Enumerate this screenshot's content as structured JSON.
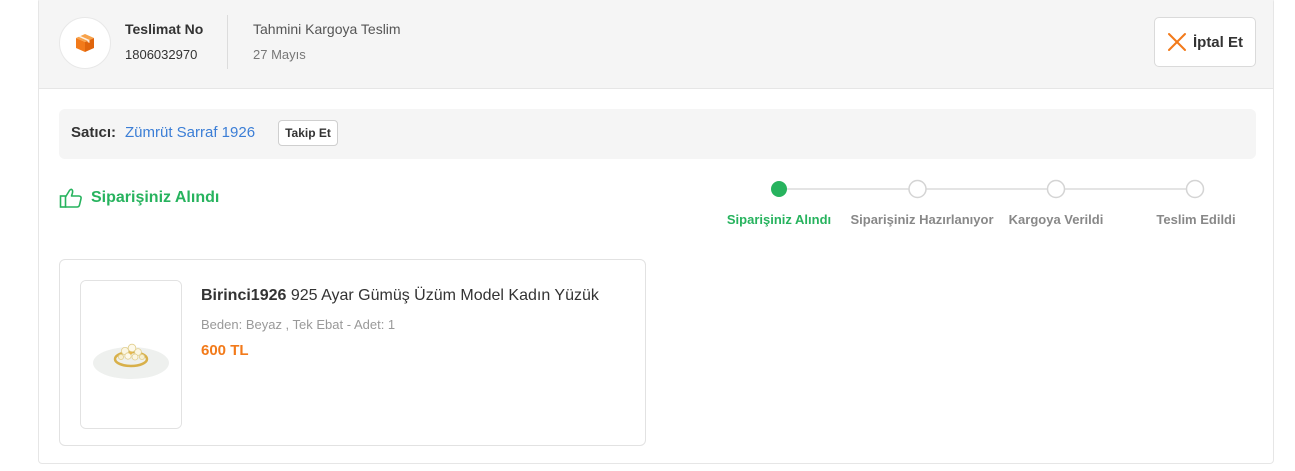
{
  "header": {
    "delivery_label": "Teslimat No",
    "delivery_no": "1806032970",
    "estimate_label": "Tahmini Kargoya Teslim",
    "estimate_date": "27 Mayıs",
    "cancel_label": "İptal Et",
    "package_icon": "package-icon",
    "cancel_icon": "close-icon"
  },
  "seller": {
    "label": "Satıcı:",
    "name": "Zümrüt Sarraf 1926",
    "follow_label": "Takip Et"
  },
  "status": {
    "text": "Siparişiniz Alındı",
    "icon": "thumbs-up-icon"
  },
  "tracker": {
    "steps": [
      {
        "label": "Siparişiniz Alındı",
        "done": true
      },
      {
        "label": "Siparişiniz Hazırlanıyor",
        "done": false
      },
      {
        "label": "Kargoya Verildi",
        "done": false
      },
      {
        "label": "Teslim Edildi",
        "done": false
      }
    ]
  },
  "product": {
    "brand": "Birinci1926",
    "name": "925 Ayar Gümüş Üzüm Model Kadın Yüzük",
    "variant": "Beden: Beyaz , Tek Ebat - Adet: 1",
    "price": "600 TL"
  },
  "colors": {
    "accent_orange": "#f27a1a",
    "success_green": "#27b35e",
    "link_blue": "#3b7ed6"
  }
}
